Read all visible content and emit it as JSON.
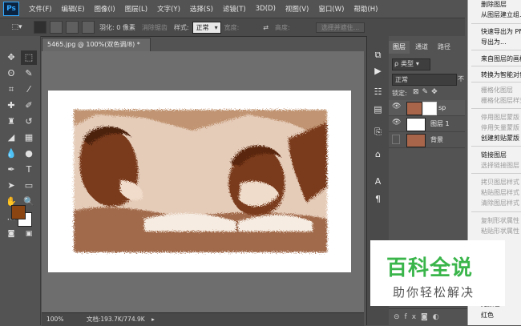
{
  "app": {
    "logo": "Ps"
  },
  "menubar": {
    "items": [
      "文件(F)",
      "编辑(E)",
      "图像(I)",
      "图层(L)",
      "文字(Y)",
      "选择(S)",
      "滤镜(T)",
      "3D(D)",
      "视图(V)",
      "窗口(W)",
      "帮助(H)"
    ]
  },
  "options": {
    "feather_label": "羽化: 0 像素",
    "antialias_label": "消除锯齿",
    "style_label": "样式:",
    "style_value": "正常",
    "width_label": "宽度:",
    "height_label": "高度:",
    "select_mask_button": "选择并遮住..."
  },
  "document": {
    "tab_title": "5465.jpg @ 100%(双色调/8) *",
    "zoom": "100%",
    "doc_size": "文档:193.7K/774.9K"
  },
  "layers_panel": {
    "tabs": [
      "图层",
      "通道",
      "路径"
    ],
    "kind_filter": "类型",
    "blend_mode": "正常",
    "opacity_short": "不",
    "lock_label": "锁定:",
    "layers": [
      {
        "name": "sp",
        "visible": true
      },
      {
        "name": "图层 1",
        "visible": true
      },
      {
        "name": "背景",
        "visible": false
      }
    ]
  },
  "context_menu": {
    "items": [
      {
        "label": "删除图层",
        "enabled": true
      },
      {
        "label": "从图层建立组...",
        "enabled": true
      },
      {
        "label": "快速导出为 PNG",
        "enabled": true
      },
      {
        "label": "导出为...",
        "enabled": true
      },
      {
        "label": "来自图层的画板...",
        "enabled": true
      },
      {
        "label": "转换为智能对象",
        "enabled": true
      },
      {
        "label": "栅格化图层",
        "enabled": false
      },
      {
        "label": "栅格化图层样式",
        "enabled": false
      },
      {
        "label": "停用图层蒙版",
        "enabled": false
      },
      {
        "label": "停用矢量蒙版",
        "enabled": false
      },
      {
        "label": "创建剪贴蒙版",
        "enabled": true
      },
      {
        "label": "链接图层",
        "enabled": true
      },
      {
        "label": "选择链接图层",
        "enabled": false
      },
      {
        "label": "拷贝图层样式",
        "enabled": false
      },
      {
        "label": "粘贴图层样式",
        "enabled": false
      },
      {
        "label": "清除图层样式",
        "enabled": false
      },
      {
        "label": "复制形状属性",
        "enabled": false
      },
      {
        "label": "粘贴形状属性",
        "enabled": false
      },
      {
        "label": "无颜色",
        "enabled": true
      },
      {
        "label": "红色",
        "enabled": true
      }
    ]
  },
  "colors": {
    "foreground": "#8b4513",
    "background": "#ffffff",
    "duotone": "#7a3a1a",
    "watermark_green": "#39b54a"
  },
  "watermark": {
    "title": "百科全说",
    "subtitle": "助你轻松解决"
  }
}
